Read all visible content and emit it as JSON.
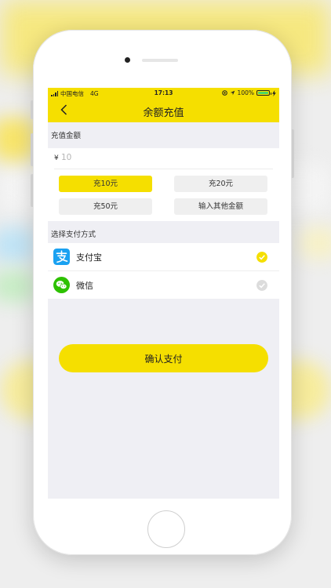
{
  "status_bar": {
    "carrier": "中国电信",
    "network": "4G",
    "time": "17:13",
    "battery": "100%"
  },
  "nav": {
    "title": "余额充值"
  },
  "recharge": {
    "section_label": "充值金额",
    "currency_symbol": "¥",
    "amount_value": "10",
    "options": [
      {
        "label": "充10元",
        "selected": true
      },
      {
        "label": "充20元",
        "selected": false
      },
      {
        "label": "充50元",
        "selected": false
      },
      {
        "label": "输入其他金额",
        "selected": false
      }
    ]
  },
  "payment": {
    "section_label": "选择支付方式",
    "methods": [
      {
        "label": "支付宝",
        "icon": "alipay-icon",
        "selected": true
      },
      {
        "label": "微信",
        "icon": "wechat-icon",
        "selected": false
      }
    ]
  },
  "confirm": {
    "label": "确认支付"
  },
  "colors": {
    "accent": "#f5df00",
    "alipay": "#1aa1f1",
    "wechat": "#2dc100"
  }
}
